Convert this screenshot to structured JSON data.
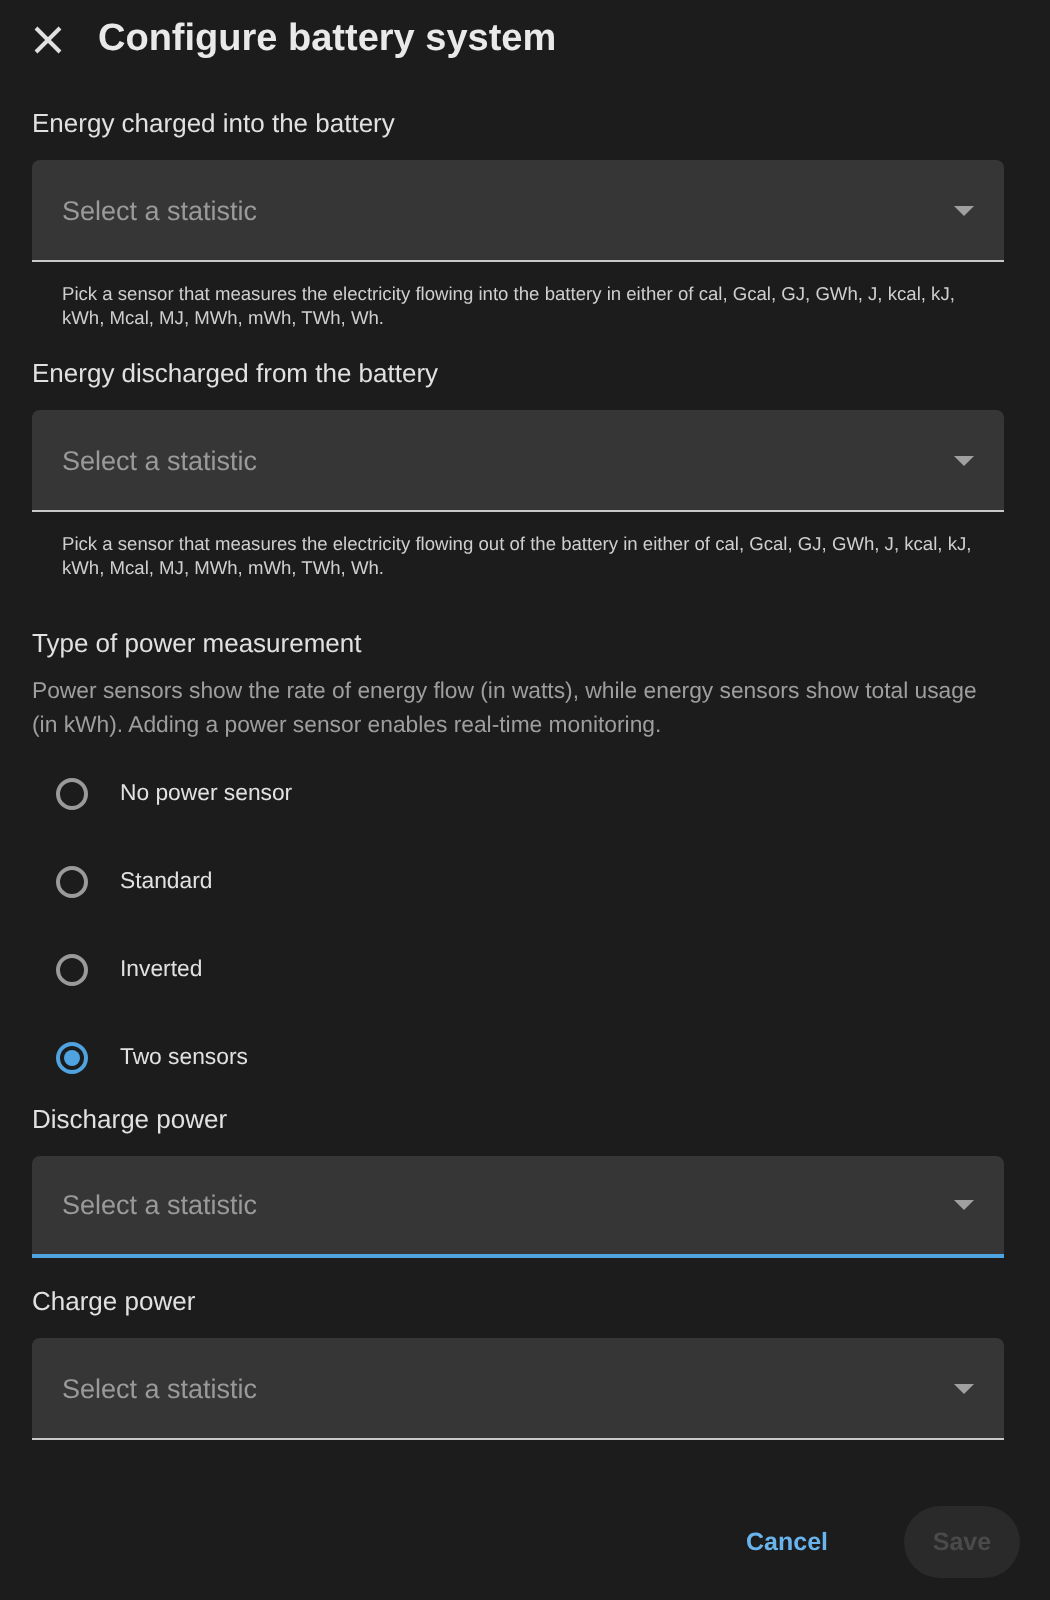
{
  "dialog": {
    "title": "Configure battery system"
  },
  "energy_fields": [
    {
      "label": "Energy charged into the battery",
      "placeholder": "Select a statistic",
      "helper": "Pick a sensor that measures the electricity flowing into the battery in either of cal, Gcal, GJ, GWh, J, kcal, kJ, kWh, Mcal, MJ, MWh, mWh, TWh, Wh.",
      "focused": false
    },
    {
      "label": "Energy discharged from the battery",
      "placeholder": "Select a statistic",
      "helper": "Pick a sensor that measures the electricity flowing out of the battery in either of cal, Gcal, GJ, GWh, J, kcal, kJ, kWh, Mcal, MJ, MWh, mWh, TWh, Wh.",
      "focused": false
    }
  ],
  "power_measurement": {
    "title": "Type of power measurement",
    "description": "Power sensors show the rate of energy flow (in watts), while energy sensors show total usage (in kWh). Adding a power sensor enables real-time monitoring.",
    "options": [
      {
        "label": "No power sensor",
        "selected": false
      },
      {
        "label": "Standard",
        "selected": false
      },
      {
        "label": "Inverted",
        "selected": false
      },
      {
        "label": "Two sensors",
        "selected": true
      }
    ]
  },
  "power_fields": [
    {
      "label": "Discharge power",
      "placeholder": "Select a statistic",
      "focused": true
    },
    {
      "label": "Charge power",
      "placeholder": "Select a statistic",
      "focused": false
    }
  ],
  "buttons": [
    {
      "label": "Cancel",
      "kind": "text",
      "disabled": false
    },
    {
      "label": "Save",
      "kind": "filled",
      "disabled": true
    }
  ]
}
